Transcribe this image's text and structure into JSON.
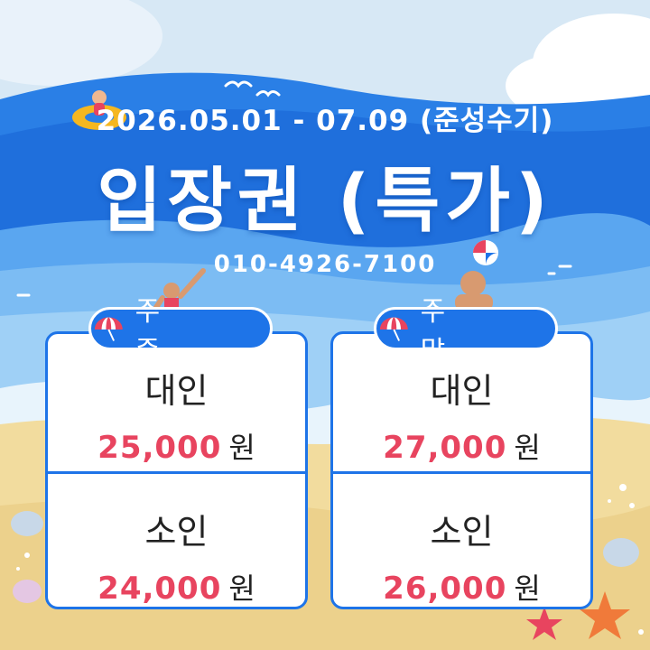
{
  "date_range": "2026.05.01 - 07.09 (준성수기)",
  "title": "입장권 (특가)",
  "phone": "010-4926-7100",
  "weekday": {
    "label": "주 중",
    "adult": {
      "label": "대인",
      "price": "25,000",
      "unit": "원"
    },
    "child": {
      "label": "소인",
      "price": "24,000",
      "unit": "원"
    }
  },
  "weekend": {
    "label": "주 말",
    "adult": {
      "label": "대인",
      "price": "27,000",
      "unit": "원"
    },
    "child": {
      "label": "소인",
      "price": "26,000",
      "unit": "원"
    }
  },
  "icons": [
    "umbrella-icon",
    "seagull-icon",
    "swimmer-icon",
    "beach-ball-icon",
    "shell-icon",
    "starfish-icon"
  ],
  "colors": {
    "accent": "#1e74e8",
    "price": "#e8445f",
    "sky": "#cfe3f3",
    "sand": "#f2dc9e"
  }
}
